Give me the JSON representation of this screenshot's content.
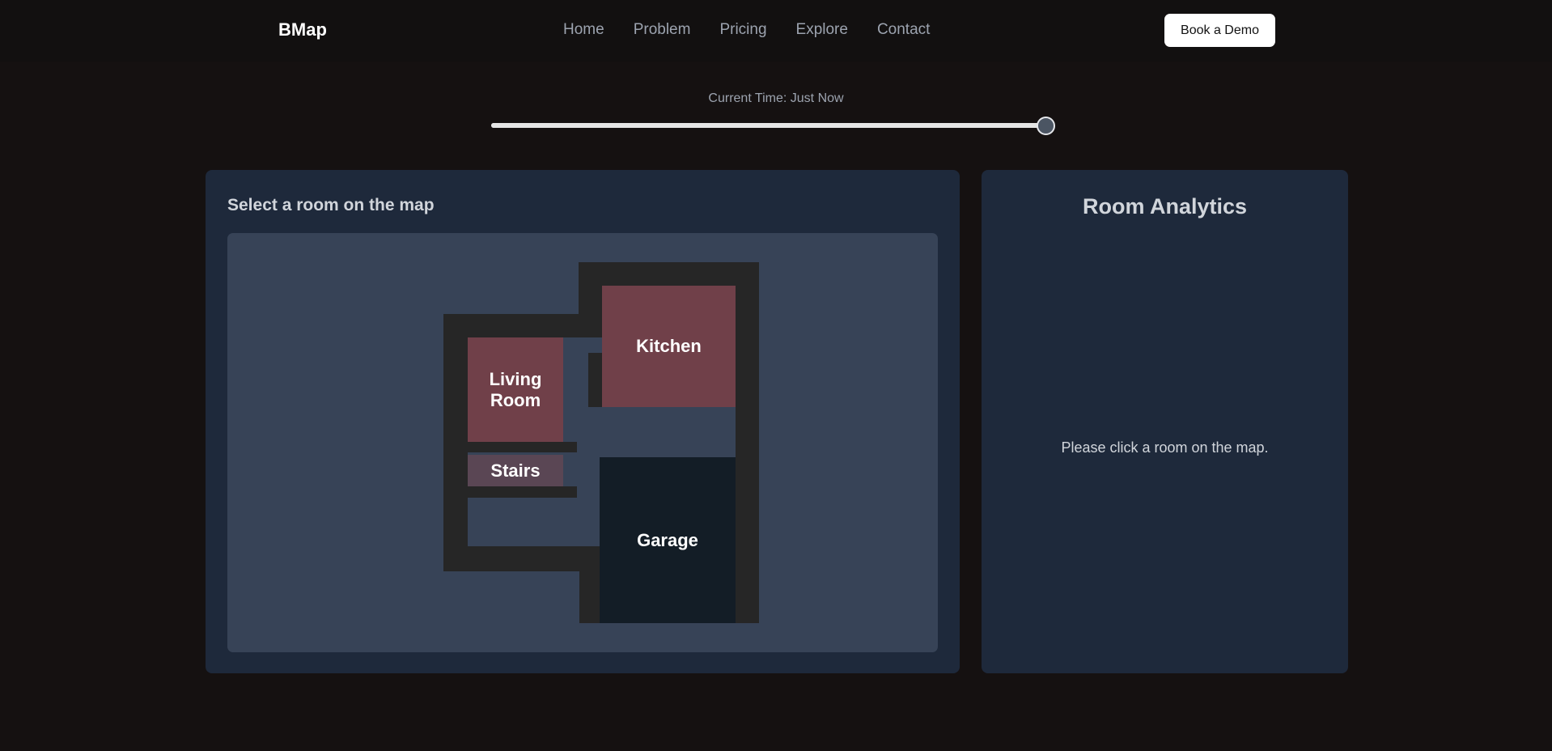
{
  "header": {
    "brand": "BMap",
    "nav": [
      "Home",
      "Problem",
      "Pricing",
      "Explore",
      "Contact"
    ],
    "cta_label": "Book a Demo"
  },
  "timeline": {
    "label": "Current Time: Just Now",
    "value_fraction": 1.0
  },
  "map_panel": {
    "title": "Select a room on the map",
    "rooms": {
      "living_room": {
        "line1": "Living",
        "line2": "Room",
        "color": "#704049"
      },
      "kitchen": {
        "label": "Kitchen",
        "color": "#704049"
      },
      "stairs": {
        "label": "Stairs",
        "color": "#5a4654"
      },
      "garage": {
        "label": "Garage",
        "color": "#131d26"
      }
    }
  },
  "analytics_panel": {
    "title": "Room Analytics",
    "empty_message": "Please click a room on the map."
  },
  "colors": {
    "page_bg": "#151111",
    "panel_bg": "#1e293b",
    "map_bg": "#374357",
    "wall": "#262626"
  }
}
